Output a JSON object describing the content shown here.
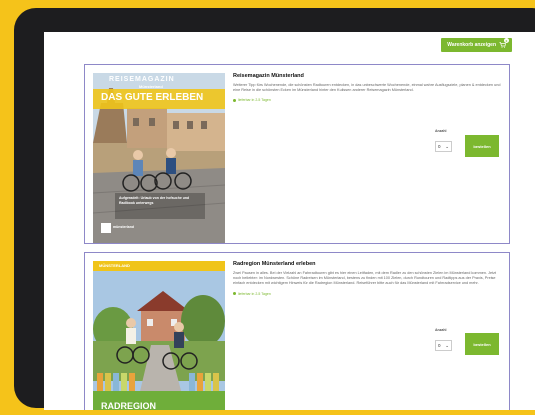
{
  "cart": {
    "button_label": "Warenkorb anzeigen",
    "count": "0",
    "icon": "cart-icon"
  },
  "products": [
    {
      "title": "Reisemagazin Münsterland",
      "description": "Weiterer Tipp fürs Wochenende, die schönsten Radtouren entdecken, in das unbeschwerte Wochenende, einmal wahre Ausflugsziele, planen & entdecken und eine Reise in die schönsten Ecken im Münsterland hinter den Kulissen anderer Reisemagazin Münsterland.",
      "availability": "lieferbar in 2-5 Tagen",
      "qty_label": "Anzahl",
      "qty_value": "0",
      "order_label": "bestellen",
      "cover": {
        "kicker": "REISEMAGAZIN",
        "subkicker": "Münsterland",
        "headline": "DAS GUTE ERLEBEN",
        "caption": "Aufgeradelt: Urlaub von der hofsuche und Radlbook unterwegs",
        "publisher": "münsterland"
      }
    },
    {
      "title": "Radregion Münsterland erleben",
      "description": "Zwei Pausen in alles. Bei der Vielzahl an Fahrradtouren gibt es hier einen Leitfaden, mit dem Radler zu den schönsten Zielen im Münsterland kommen. Jetzt noch beliebter: im Nordwesten. Schöne Radreisen im Münsterland, bestens zu finden mit 100 Zielen, durch Rundtouren und Radtipps aus der Praxis, Preise einfach entdecken mit wichtigem Hinweis für die Radregion Münsterland. Reiseführer bitte auch für das Münsterland mit Fahrradservice und mehr.",
      "availability": "lieferbar in 2-5 Tagen",
      "qty_label": "Anzahl",
      "qty_value": "0",
      "order_label": "bestellen",
      "cover": {
        "topbar": "MÜNSTERLAND",
        "headline": "RADREGION"
      }
    }
  ]
}
